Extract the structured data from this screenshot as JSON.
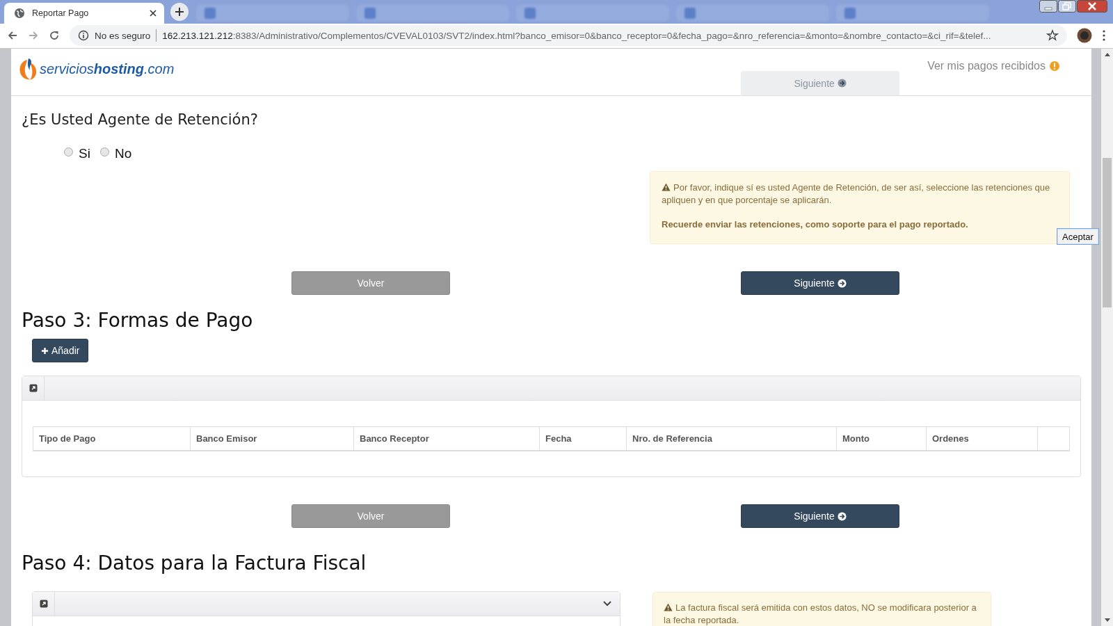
{
  "browser": {
    "tab": {
      "title": "Reportar Pago",
      "selected": true
    },
    "address": {
      "security": "No es seguro",
      "host": "162.213.121.212",
      "path": ":8383/Administrativo/Complementos/CVEVAL0103/SVT2/index.html?banco_emisor=0&banco_receptor=0&fecha_pago=&nro_referencia=&monto=&nombre_contacto=&ci_rif=&telef..."
    }
  },
  "header": {
    "logo": "servicios**hosting**.com",
    "link": "Ver mis pagos recibidos",
    "floating_button": {
      "label": "Siguiente",
      "disabled": true
    }
  },
  "retention": {
    "question": "¿Es Usted Agente de Retención?",
    "options": [
      {
        "label": "Si",
        "selected": false
      },
      {
        "label": "No",
        "selected": false
      }
    ],
    "alert": {
      "message": "Por favor, indique sí es usted Agente de Retención, de ser así, seleccione las retenciones que apliquen y en que porcentaje se aplicarán.",
      "note": "Recuerde enviar las retenciones, como soporte para el pago reportado."
    },
    "buttons": {
      "back": "Volver",
      "next": "Siguiente"
    }
  },
  "step3": {
    "title": "Paso 3: Formas de Pago",
    "add_button": "Añadir",
    "table": {
      "columns": [
        "Tipo de Pago",
        "Banco Emisor",
        "Banco Receptor",
        "Fecha",
        "Nro. de Referencia",
        "Monto",
        "Ordenes",
        ""
      ]
    },
    "buttons": {
      "back": "Volver",
      "next": "Siguiente"
    }
  },
  "step4": {
    "title": "Paso 4: Datos para la Factura Fiscal",
    "alert": "La factura fiscal será emitida con estos datos, NO se modificara posterior a la fecha reportada."
  },
  "popup": {
    "button": "Aceptar"
  }
}
